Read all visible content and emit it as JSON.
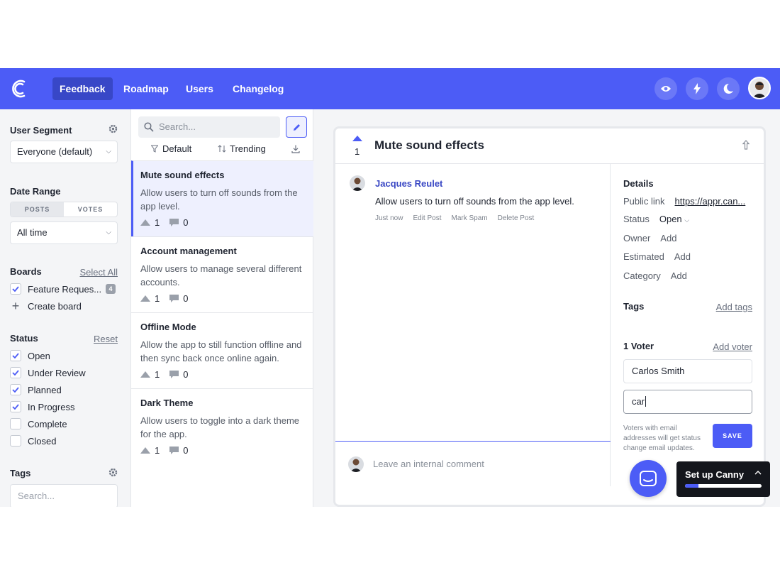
{
  "nav": {
    "tabs": [
      "Feedback",
      "Roadmap",
      "Users",
      "Changelog"
    ],
    "active_tab": "Feedback"
  },
  "header_icons": [
    "eye-icon",
    "bolt-icon",
    "moon-icon"
  ],
  "sidebar": {
    "user_segment": {
      "label": "User Segment",
      "value": "Everyone (default)"
    },
    "date_range": {
      "label": "Date Range",
      "toggle": [
        "POSTS",
        "VOTES"
      ],
      "value": "All time"
    },
    "boards": {
      "label": "Boards",
      "select_all": "Select All",
      "board_name": "Feature Reques...",
      "board_count": "4",
      "create_board": "Create board"
    },
    "status": {
      "label": "Status",
      "reset": "Reset",
      "items": [
        {
          "label": "Open",
          "checked": true
        },
        {
          "label": "Under Review",
          "checked": true
        },
        {
          "label": "Planned",
          "checked": true
        },
        {
          "label": "In Progress",
          "checked": true
        },
        {
          "label": "Complete",
          "checked": false
        },
        {
          "label": "Closed",
          "checked": false
        }
      ]
    },
    "tags": {
      "label": "Tags",
      "search_placeholder": "Search..."
    }
  },
  "list": {
    "search_placeholder": "Search...",
    "filter_default": "Default",
    "filter_trending": "Trending",
    "posts": [
      {
        "title": "Mute sound effects",
        "desc": "Allow users to turn off sounds from the app level.",
        "votes": "1",
        "comments": "0"
      },
      {
        "title": "Account management",
        "desc": "Allow users to manage several different accounts.",
        "votes": "1",
        "comments": "0"
      },
      {
        "title": "Offline Mode",
        "desc": "Allow the app to still function offline and then sync back once online again.",
        "votes": "1",
        "comments": "0"
      },
      {
        "title": "Dark Theme",
        "desc": "Allow users to toggle into a dark theme for the app.",
        "votes": "1",
        "comments": "0"
      }
    ]
  },
  "detail": {
    "votes": "1",
    "title": "Mute sound effects",
    "author": "Jacques Reulet",
    "body": "Allow users to turn off sounds from the app level.",
    "actions": [
      "Just now",
      "Edit Post",
      "Mark Spam",
      "Delete Post"
    ],
    "comment_placeholder": "Leave an internal comment",
    "details_label": "Details",
    "public_link_label": "Public link",
    "public_link_value": "https://appr.can...",
    "status_label": "Status",
    "status_value": "Open",
    "owner_label": "Owner",
    "estimated_label": "Estimated",
    "category_label": "Category",
    "add_label": "Add",
    "tags_label": "Tags",
    "add_tags": "Add tags",
    "voters_label": "1 Voter",
    "add_voter": "Add voter",
    "voter_name": "Carlos Smith",
    "voter_input": "car",
    "voter_note": "Voters with email addresses will get status change email updates.",
    "save_label": "SAVE"
  },
  "setup": {
    "label": "Set up Canny",
    "progress": 0.18
  },
  "colors": {
    "brand": "#4c5cf6",
    "brand_dark": "#3847c7"
  }
}
